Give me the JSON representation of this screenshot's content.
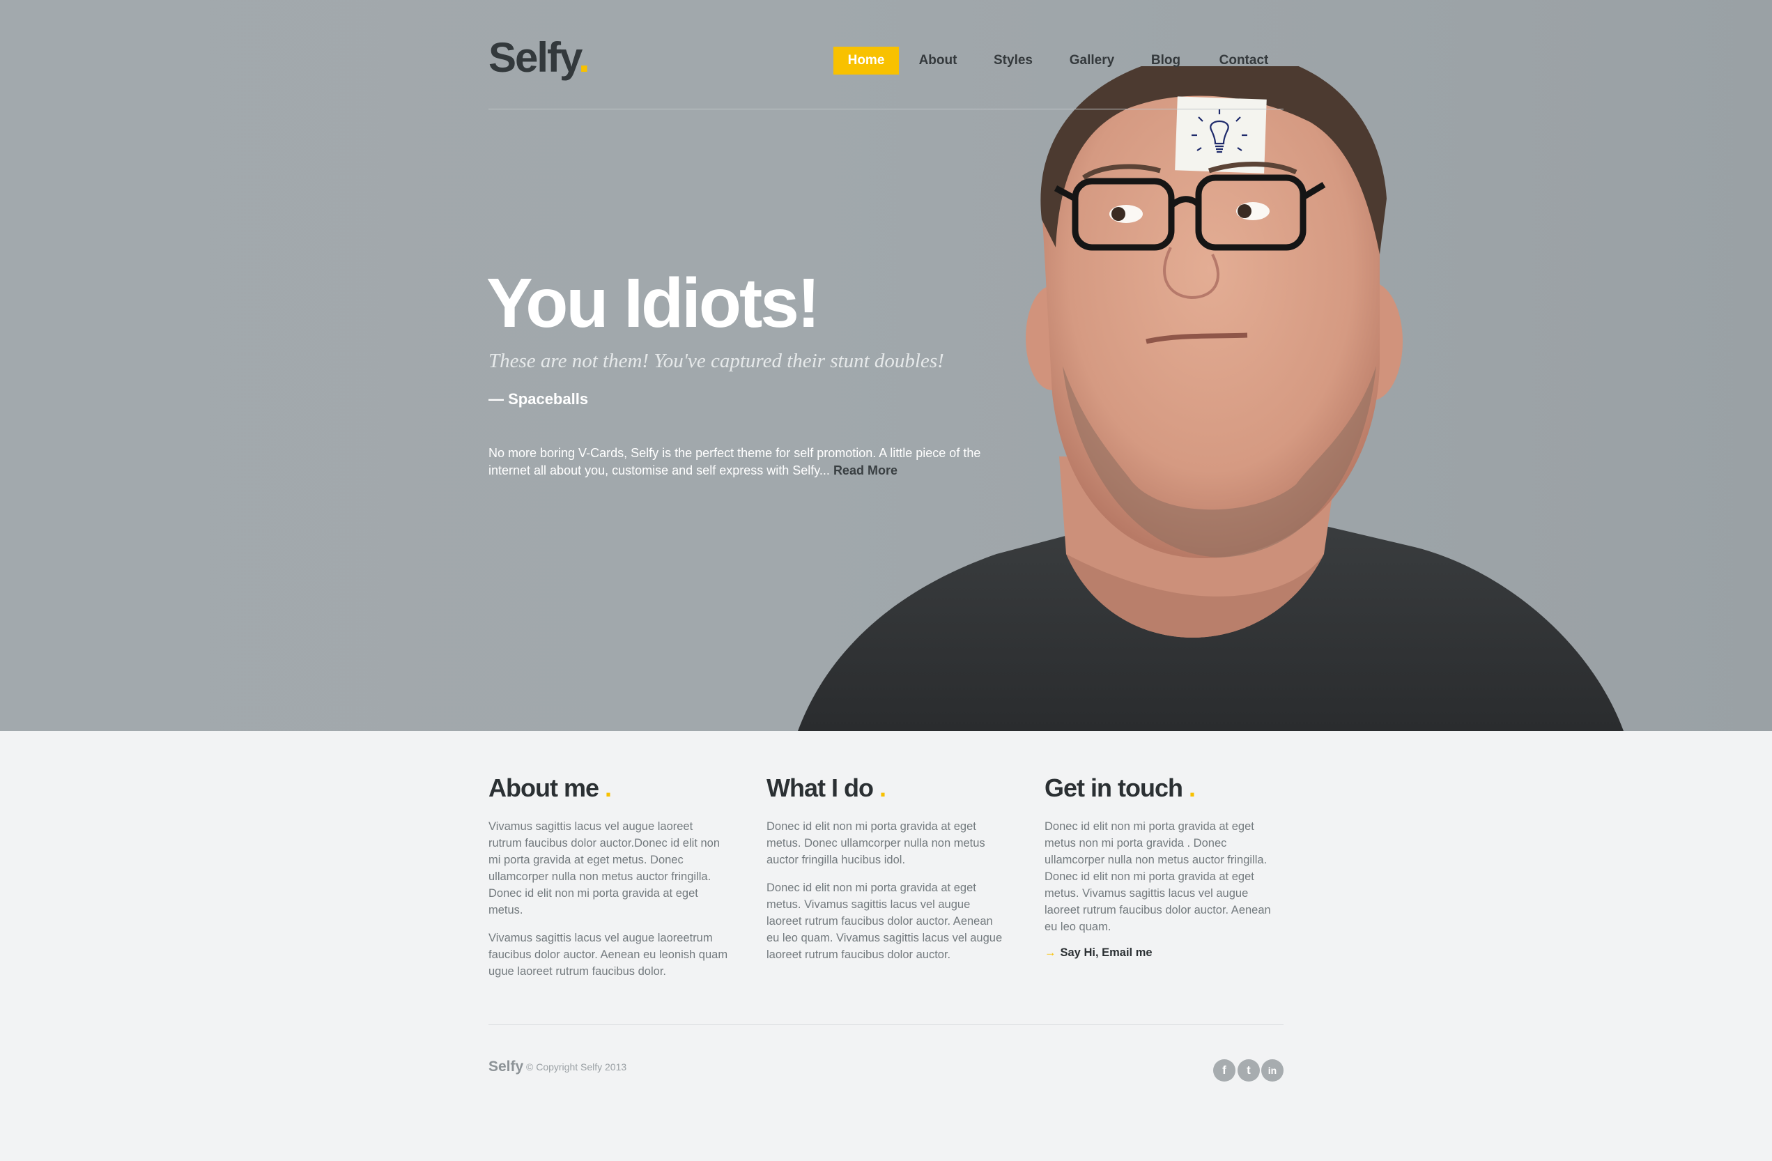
{
  "brand": {
    "name": "Selfy",
    "dot": ".",
    "accent_color": "#f8c100"
  },
  "nav": {
    "items": [
      {
        "label": "Home",
        "active": true
      },
      {
        "label": "About"
      },
      {
        "label": "Styles"
      },
      {
        "label": "Gallery"
      },
      {
        "label": "Blog"
      },
      {
        "label": "Contact"
      }
    ]
  },
  "hero": {
    "headline": "You Idiots!",
    "quote": "These are not them! You've captured their stunt doubles!",
    "cite": "— Spaceballs",
    "intro": "No more boring V-Cards, Selfy is the perfect theme for self promotion. A little piece of the internet all about you, customise and self express with Selfy...",
    "read_more": "Read More",
    "background_color": "#a2a9ad"
  },
  "columns": [
    {
      "title": "About me",
      "paragraphs": [
        "Vivamus sagittis lacus vel augue laoreet rutrum faucibus dolor auctor.Donec id elit non mi porta gravida at eget metus. Donec ullamcorper nulla non metus auctor fringilla. Donec id elit non mi porta gravida at eget metus.",
        "Vivamus sagittis lacus vel augue laoreetrum faucibus dolor auctor. Aenean eu leonish quam ugue laoreet rutrum faucibus dolor."
      ]
    },
    {
      "title": "What I do",
      "paragraphs": [
        "Donec id elit non mi porta gravida at eget metus. Donec ullamcorper nulla non metus auctor fringilla hucibus idol.",
        "Donec id elit non mi porta gravida at eget metus. Vivamus sagittis lacus vel augue laoreet rutrum faucibus dolor auctor. Aenean eu leo quam. Vivamus sagittis lacus vel augue laoreet rutrum faucibus dolor auctor."
      ]
    },
    {
      "title": "Get in touch",
      "paragraphs": [
        "Donec id elit non mi porta gravida at eget metus non mi porta gravida . Donec ullamcorper nulla non metus auctor fringilla. Donec id elit non mi porta gravida at eget metus. Vivamus sagittis lacus vel augue laoreet rutrum faucibus dolor auctor. Aenean eu leo quam."
      ],
      "link": "Say Hi, Email me",
      "link_arrow": "→"
    }
  ],
  "footer": {
    "logo": "Selfy",
    "copyright": "© Copyright Selfy 2013",
    "social": [
      {
        "icon": "facebook-icon",
        "glyph": "f"
      },
      {
        "icon": "twitter-icon",
        "glyph": "t"
      },
      {
        "icon": "linkedin-icon",
        "glyph": "in"
      }
    ]
  }
}
